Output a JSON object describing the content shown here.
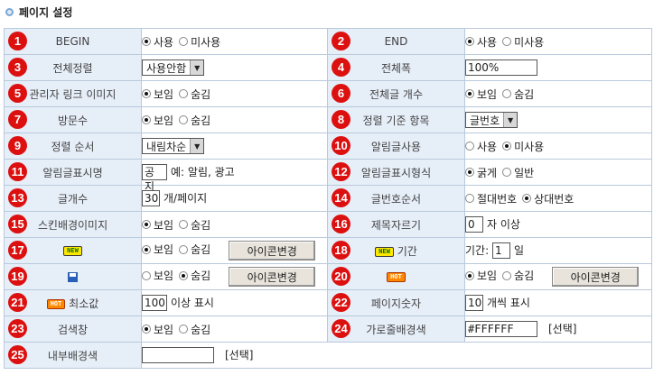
{
  "page_title": "페이지 설정",
  "rows": [
    {
      "left": {
        "num": "1",
        "label": "BEGIN",
        "type": "radio",
        "options": [
          "사용",
          "미사용"
        ],
        "selected": 0
      },
      "right": {
        "num": "2",
        "label": "END",
        "type": "radio",
        "options": [
          "사용",
          "미사용"
        ],
        "selected": 0
      }
    },
    {
      "left": {
        "num": "3",
        "label": "전체정렬",
        "type": "select",
        "value": "사용안함"
      },
      "right": {
        "num": "4",
        "label": "전체폭",
        "type": "input",
        "value": "100%"
      }
    },
    {
      "left": {
        "num": "5",
        "label": "관리자 링크 이미지",
        "type": "radio",
        "options": [
          "보임",
          "숨김"
        ],
        "selected": 0
      },
      "right": {
        "num": "6",
        "label": "전체글 개수",
        "type": "radio",
        "options": [
          "보임",
          "숨김"
        ],
        "selected": 0
      }
    },
    {
      "left": {
        "num": "7",
        "label": "방문수",
        "type": "radio",
        "options": [
          "보임",
          "숨김"
        ],
        "selected": 0
      },
      "right": {
        "num": "8",
        "label": "정렬 기준 항목",
        "type": "select",
        "value": "글번호"
      }
    },
    {
      "left": {
        "num": "9",
        "label": "정렬 순서",
        "type": "select",
        "value": "내림차순"
      },
      "right": {
        "num": "10",
        "label": "알림글사용",
        "type": "radio",
        "options": [
          "사용",
          "미사용"
        ],
        "selected": 1
      }
    },
    {
      "left": {
        "num": "11",
        "label": "알림글표시명",
        "type": "input_suffix",
        "value": "공지",
        "suffix": "예: 알림, 광고"
      },
      "right": {
        "num": "12",
        "label": "알림글표시형식",
        "type": "radio",
        "options": [
          "굵게",
          "일반"
        ],
        "selected": 0
      }
    },
    {
      "left": {
        "num": "13",
        "label": "글개수",
        "type": "input_suffix",
        "value": "30",
        "suffix": "개/페이지"
      },
      "right": {
        "num": "14",
        "label": "글번호순서",
        "type": "radio",
        "options": [
          "절대번호",
          "상대번호"
        ],
        "selected": 1
      }
    },
    {
      "left": {
        "num": "15",
        "label": "스킨배경이미지",
        "type": "radio",
        "options": [
          "보임",
          "숨김"
        ],
        "selected": 0
      },
      "right": {
        "num": "16",
        "label": "제목자르기",
        "type": "input_suffix",
        "value": "0",
        "suffix": "자 이상"
      }
    },
    {
      "left": {
        "num": "17",
        "label": "NEW",
        "icon": "new-badge-icon",
        "type": "radio_btn",
        "options": [
          "보임",
          "숨김"
        ],
        "selected": 0,
        "button": "아이콘변경"
      },
      "right": {
        "num": "18",
        "label": "기간",
        "icon": "new-badge-icon",
        "type": "prefix_input",
        "prefix": "기간:",
        "value": "1",
        "suffix": "일"
      }
    },
    {
      "left": {
        "num": "19",
        "label": "",
        "icon": "disk-icon",
        "type": "radio_btn",
        "options": [
          "보임",
          "숨김"
        ],
        "selected": 1,
        "button": "아이콘변경"
      },
      "right": {
        "num": "20",
        "label": "HOT",
        "icon": "hot-badge-icon",
        "type": "radio_btn",
        "options": [
          "보임",
          "숨김"
        ],
        "selected": 0,
        "button": "아이콘변경"
      }
    },
    {
      "left": {
        "num": "21",
        "label": "최소값",
        "icon": "hot-badge-icon",
        "type": "input_suffix",
        "value": "100",
        "suffix": "이상 표시"
      },
      "right": {
        "num": "22",
        "label": "페이지숫자",
        "type": "input_suffix",
        "value": "10",
        "suffix": "개씩 표시"
      }
    },
    {
      "left": {
        "num": "23",
        "label": "검색창",
        "type": "radio",
        "options": [
          "보임",
          "숨김"
        ],
        "selected": 0
      },
      "right": {
        "num": "24",
        "label": "가로줄배경색",
        "type": "input_suffix",
        "value": "#FFFFFF",
        "suffix": "[선택]"
      }
    },
    {
      "left": {
        "num": "25",
        "label": "내부배경색",
        "type": "input_suffix",
        "value": "",
        "suffix": "[선택]"
      },
      "right": null
    }
  ],
  "colors": {
    "accent": "#dd1010",
    "label_bg": "#e6eef8",
    "border": "#b9c9dc"
  }
}
